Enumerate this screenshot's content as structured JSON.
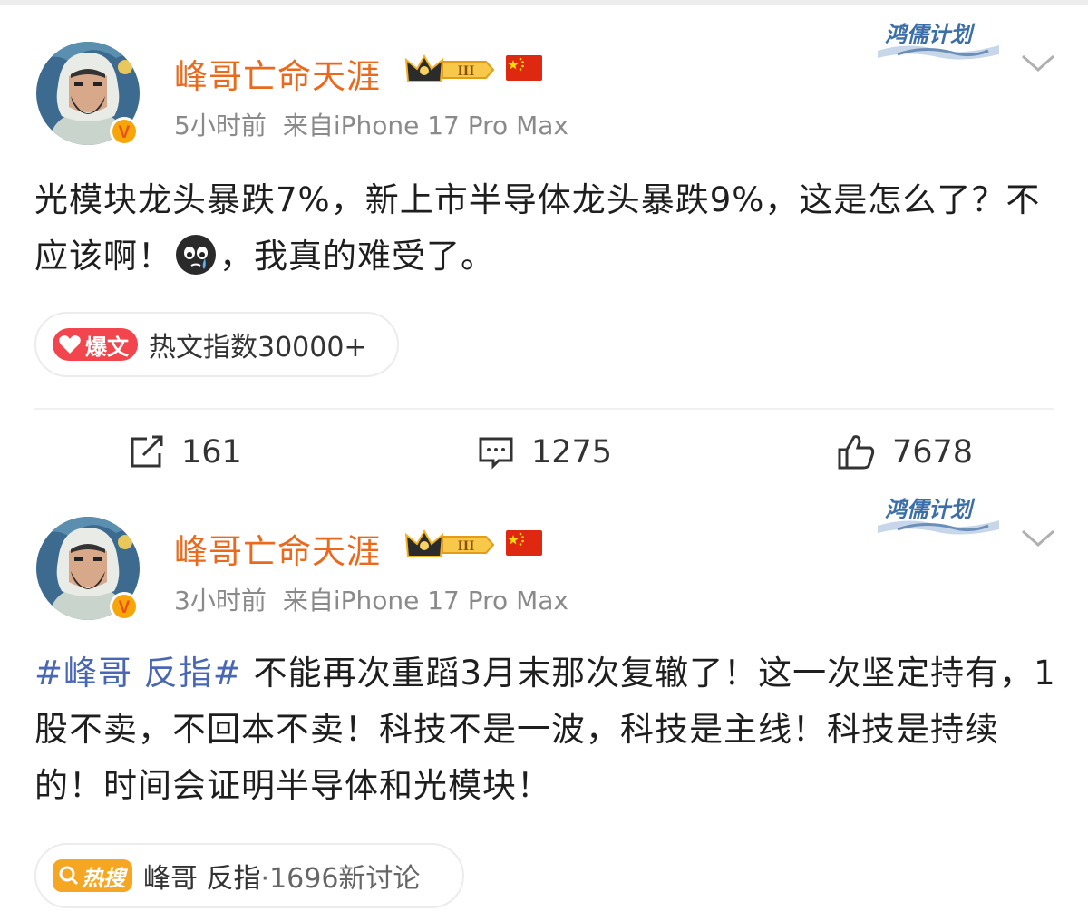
{
  "posts": [
    {
      "username": "峰哥亡命天涯",
      "time": "5小时前",
      "source": "来自iPhone 17 Pro Max",
      "brand_label": "鸿儒计划",
      "text_before_emoji": "光模块龙头暴跌7%，新上市半导体龙头暴跌9%，这是怎么了？不应该啊！",
      "emoji_icon": "crying-face-emoji",
      "text_after_emoji": "，我真的难受了。",
      "tag_badge": "爆文",
      "tag_text": "热文指数30000+",
      "actions": {
        "reposts": "161",
        "comments": "1275",
        "likes": "7678"
      }
    },
    {
      "username": "峰哥亡命天涯",
      "time": "3小时前",
      "source": "来自iPhone 17 Pro Max",
      "brand_label": "鸿儒计划",
      "hashtag": "#峰哥 反指#",
      "text": "不能再次重蹈3月末那次复辙了！这一次坚定持有，1股不卖，不回本不卖！科技不是一波，科技是主线！科技是持续的！时间会证明半导体和光模块！",
      "tag_badge": "热搜",
      "tag_topic": "峰哥 反指",
      "tag_count": "·1696新讨论"
    }
  ],
  "level_badge": "III",
  "colors": {
    "username": "#ea6a1d",
    "hashtag": "#4a67b3",
    "meta": "#8a8a8a",
    "baowen_badge": "#f2454d",
    "resou_badge": "#f5a623"
  }
}
